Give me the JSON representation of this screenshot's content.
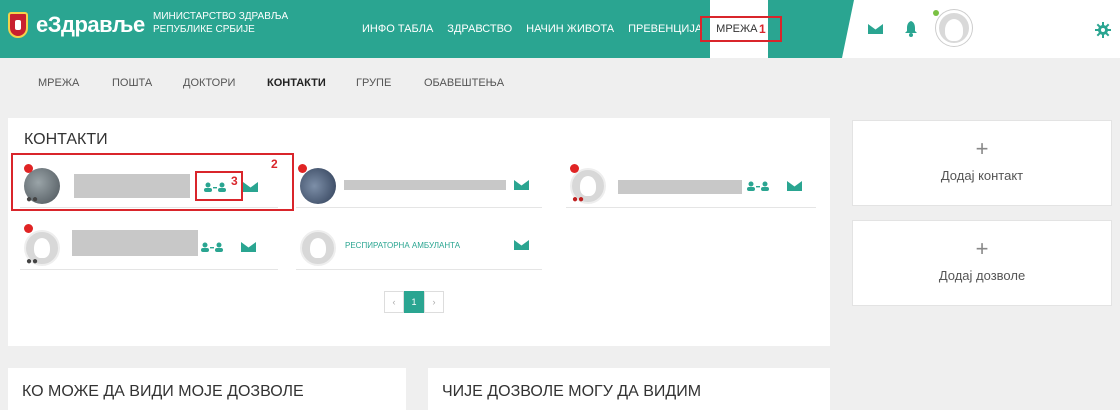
{
  "header": {
    "brand": "eЗдравље",
    "ministry_line1": "МИНИСТАРСТВО ЗДРАВЉА",
    "ministry_line2": "РЕПУБЛИКЕ СРБИЈЕ",
    "nav": [
      "ИНФО ТАБЛА",
      "ЗДРАВСТВО",
      "НАЧИН ЖИВОТА",
      "ПРЕВЕНЦИЈА"
    ],
    "nav_active": "МРЕЖА",
    "accent_color": "#2aa591"
  },
  "subnav": {
    "items": [
      "МРЕЖА",
      "ПОШТА",
      "ДОКТОРИ",
      "КОНТАКТИ",
      "ГРУПЕ",
      "ОБАВЕШТЕЊА"
    ],
    "active": "КОНТАКТИ"
  },
  "contacts": {
    "title": "КОНТАКТИ",
    "named_contact": "РЕСПИРАТОРНА АМБУЛАНТА",
    "pagination": {
      "prev": "‹",
      "current": "1",
      "next": "›"
    }
  },
  "side": {
    "add_contact_plus": "+",
    "add_contact": "Додај контакт",
    "add_permission_plus": "+",
    "add_permission": "Додај дозволе"
  },
  "bottom": {
    "who_can_see": "КО МОЖЕ ДА ВИДИ МОЈЕ ДОЗВОЛЕ",
    "whose_i_see": "ЧИЈЕ ДОЗВОЛЕ МОГУ ДА ВИДИМ"
  },
  "annotations": [
    "1",
    "2",
    "3"
  ]
}
